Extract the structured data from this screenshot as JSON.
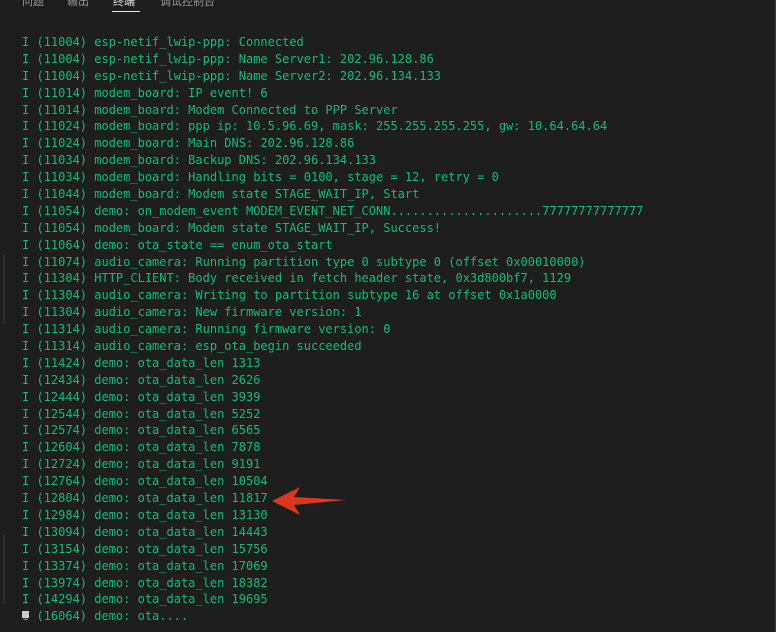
{
  "tabs": [
    {
      "label": "问题"
    },
    {
      "label": "输出"
    },
    {
      "label": "终端"
    },
    {
      "label": "调试控制台"
    }
  ],
  "active_tab": "终端",
  "colors": {
    "background": "#1e1e1e",
    "log_text": "#0dbc79",
    "annotation_arrow": "#d9381e"
  },
  "terminal": {
    "lines": [
      "I (11004) esp-netif_lwip-ppp: Connected",
      "I (11004) esp-netif_lwip-ppp: Name Server1: 202.96.128.86",
      "I (11004) esp-netif_lwip-ppp: Name Server2: 202.96.134.133",
      "I (11014) modem_board: IP event! 6",
      "I (11014) modem_board: Modem Connected to PPP Server",
      "I (11024) modem_board: ppp ip: 10.5.96.69, mask: 255.255.255.255, gw: 10.64.64.64",
      "I (11024) modem_board: Main DNS: 202.96.128.86",
      "I (11034) modem_board: Backup DNS: 202.96.134.133",
      "I (11034) modem_board: Handling bits = 0100, stage = 12, retry = 0",
      "I (11044) modem_board: Modem state STAGE_WAIT_IP, Start",
      "I (11054) demo: on_modem_event MODEM_EVENT_NET_CONN.....................77777777777777",
      "I (11054) modem_board: Modem state STAGE_WAIT_IP, Success!",
      "I (11064) demo: ota_state == enum_ota_start",
      "I (11074) audio_camera: Running partition type 0 subtype 0 (offset 0x00010000)",
      "I (11304) HTTP_CLIENT: Body received in fetch header state, 0x3d800bf7, 1129",
      "I (11304) audio_camera: Writing to partition subtype 16 at offset 0x1a0000",
      "I (11304) audio_camera: New firmware version: 1",
      "I (11314) audio_camera: Running firmware version: 0",
      "I (11314) audio_camera: esp_ota_begin succeeded",
      "I (11424) demo: ota_data_len 1313",
      "I (12434) demo: ota_data_len 2626",
      "I (12444) demo: ota_data_len 3939",
      "I (12544) demo: ota_data_len 5252",
      "I (12574) demo: ota_data_len 6565",
      "I (12604) demo: ota_data_len 7878",
      "I (12724) demo: ota_data_len 9191",
      "I (12764) demo: ota_data_len 10504",
      "I (12804) demo: ota_data_len 11817",
      "I (12984) demo: ota_data_len 13130",
      "I (13094) demo: ota_data_len 14443",
      "I (13154) demo: ota_data_len 15756",
      "I (13374) demo: ota_data_len 17069",
      "I (13974) demo: ota_data_len 18382",
      "I (14294) demo: ota_data_len 19695",
      "I (16064) demo: ota...."
    ]
  },
  "annotation": {
    "icon": "red-arrow-icon",
    "points_to_line": "I (12804) demo: ota_data_len 11817"
  }
}
